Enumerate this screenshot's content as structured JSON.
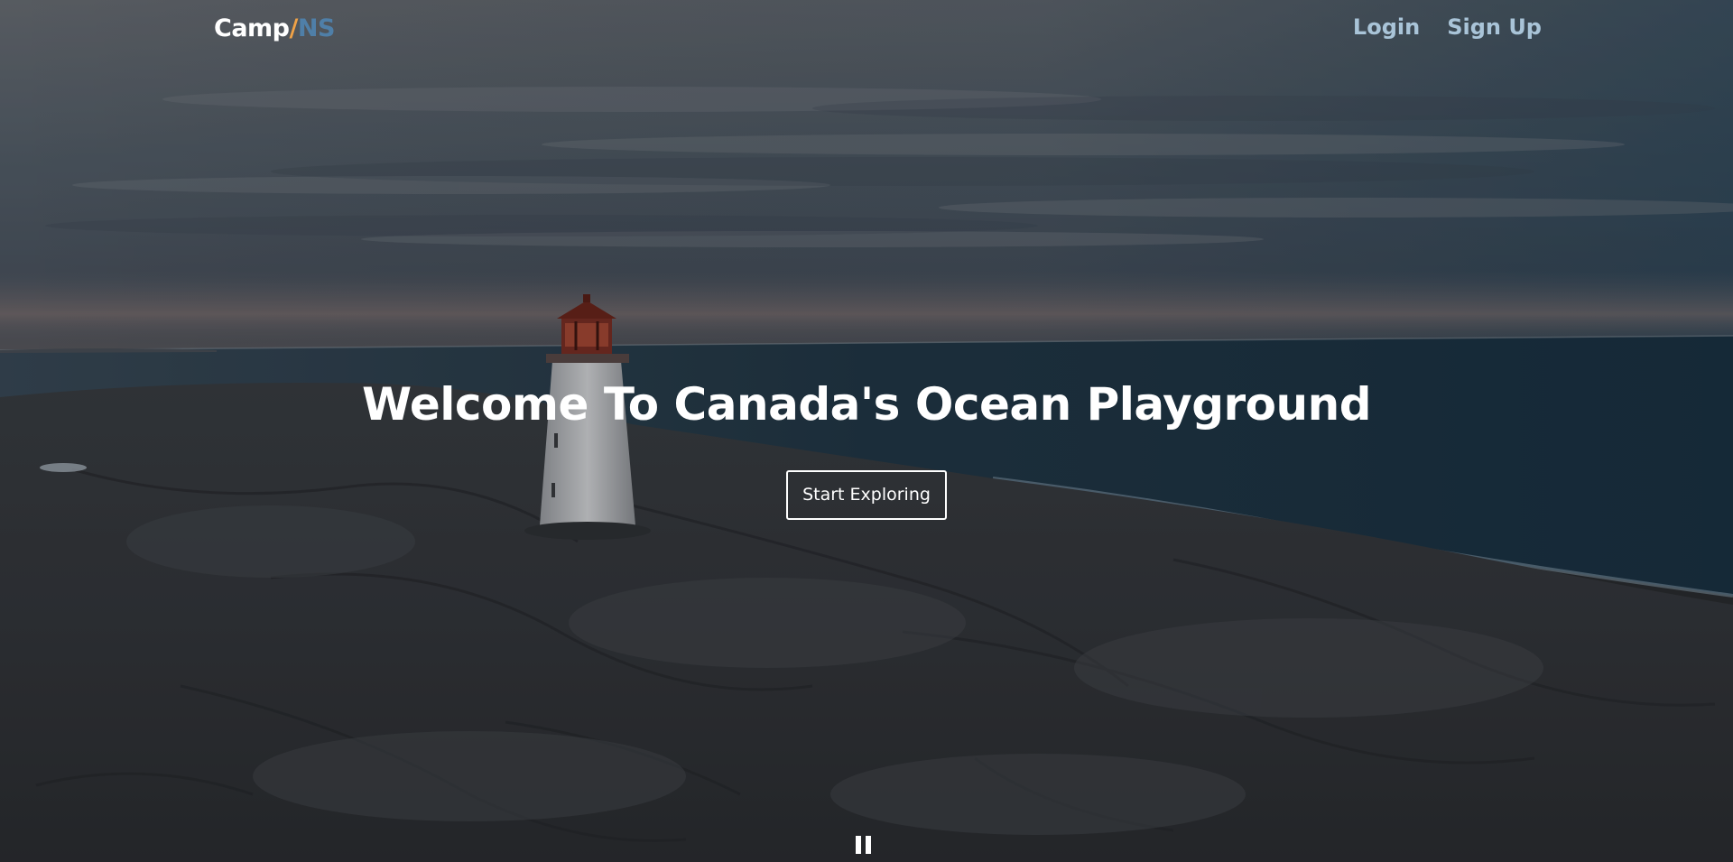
{
  "navbar": {
    "brand": {
      "part1": "Camp",
      "part2": "/",
      "part3": "NS"
    },
    "links": {
      "login": "Login",
      "signup": "Sign Up"
    }
  },
  "hero": {
    "title": "Welcome To Canada's Ocean Playground",
    "cta_label": "Start Exploring"
  },
  "background": {
    "description_icon": "video-background-lighthouse",
    "state": "playing"
  },
  "controls": {
    "pause_icon": "pause-icon"
  },
  "colors": {
    "brand_slash": "#f0a247",
    "brand_ns": "#4f7fa8",
    "nav_link": "#a9c4d8",
    "text": "#ffffff"
  }
}
